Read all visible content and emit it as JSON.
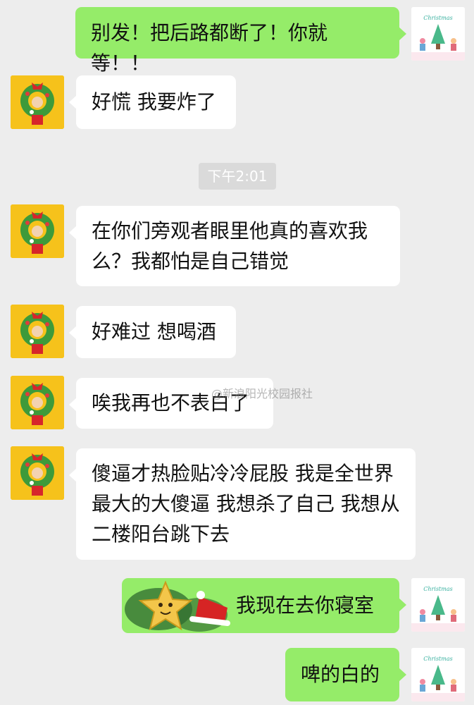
{
  "chat": {
    "timestamp": "下午2:01",
    "watermark": "@新浪阳光校园报社",
    "messages": [
      {
        "side": "out",
        "text": "别发！把后路都断了！你就等！！"
      },
      {
        "side": "in",
        "text": "好慌 我要炸了"
      },
      {
        "side": "in",
        "text": "在你们旁观者眼里他真的喜欢我么？我都怕是自己错觉"
      },
      {
        "side": "in",
        "text": "好难过 想喝酒"
      },
      {
        "side": "in",
        "text": "唉我再也不表白了"
      },
      {
        "side": "in",
        "text": "傻逼才热脸贴冷冷屁股 我是全世界最大的大傻逼 我想杀了自己 我想从二楼阳台跳下去"
      },
      {
        "side": "out",
        "text": "我现在去你寝室",
        "sticker": "star-santa-hat-sticker"
      },
      {
        "side": "out",
        "text": "啤的白的"
      }
    ]
  },
  "colors": {
    "background": "#ededed",
    "outgoing_bubble": "#95ec69",
    "incoming_bubble": "#ffffff"
  },
  "avatars": {
    "left": "wreath-character-avatar",
    "right": "christmas-card-avatar"
  }
}
